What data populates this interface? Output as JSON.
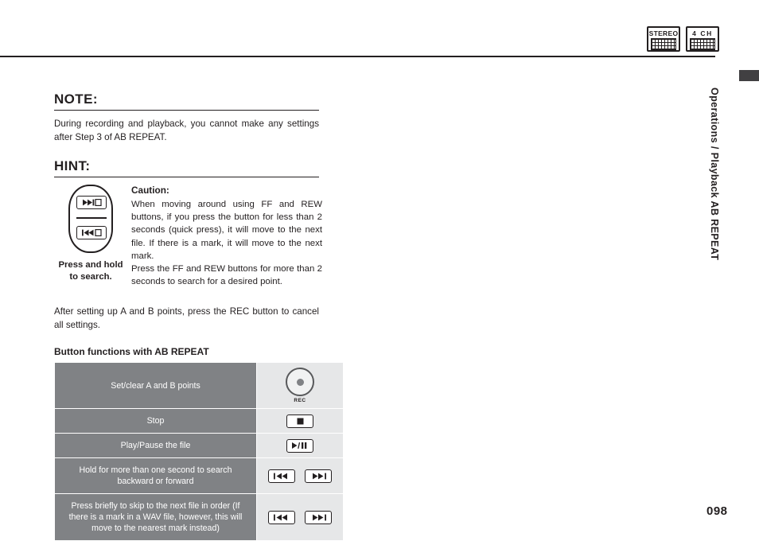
{
  "badges": [
    {
      "label": "STEREO",
      "icon": "grid-icon"
    },
    {
      "label": "4 CH",
      "icon": "grid-icon"
    }
  ],
  "side_tab": {
    "text": "Operations / Playback AB REPEAT"
  },
  "note": {
    "title": "NOTE:",
    "body": "During recording and playback, you cannot make any settings after Step 3 of AB REPEAT."
  },
  "hint": {
    "title": "HINT:",
    "caption": "Press and hold to search.",
    "caution_title": "Caution:",
    "caution_p1": "When moving around using FF and REW buttons, if you press the button for less than 2 seconds (quick press), it will move to the next file. If there is a mark, it will move to the next mark.",
    "caution_p2": "Press the FF and REW buttons for more than 2 seconds to search for a desired point."
  },
  "after_text": "After setting up A and B points, press the REC button to cancel all settings.",
  "table": {
    "title": "Button functions with AB REPEAT",
    "rows": [
      {
        "desc": "Set/clear A and B points",
        "controls": [
          "rec-button"
        ],
        "rec_label": "REC"
      },
      {
        "desc": "Stop",
        "controls": [
          "stop-button"
        ]
      },
      {
        "desc": "Play/Pause the file",
        "controls": [
          "play-pause-button"
        ]
      },
      {
        "desc": "Hold for more than one second to search backward or forward",
        "controls": [
          "rew-button",
          "ff-button"
        ]
      },
      {
        "desc": "Press briefly to skip to the next file in order (If there is a mark in a WAV file, however, this will move to the nearest mark instead)",
        "controls": [
          "rew-button",
          "ff-button"
        ]
      }
    ]
  },
  "page_number": "098",
  "colors": {
    "desc_cell": "#808285",
    "ctrl_cell": "#e6e7e8",
    "text": "#231f20",
    "tab": "#414042"
  }
}
